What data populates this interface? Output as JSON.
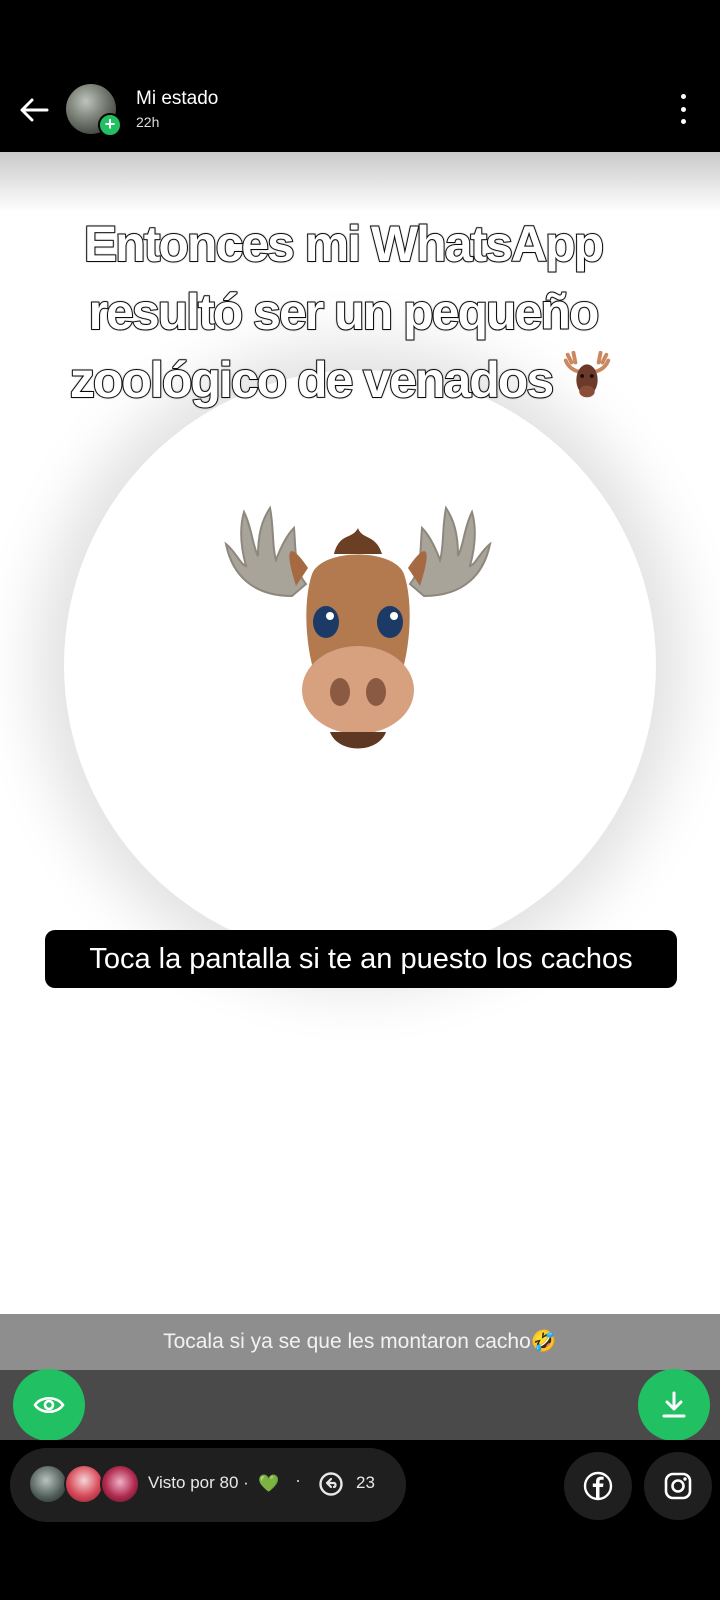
{
  "header": {
    "title": "Mi estado",
    "time": "22h",
    "avatar_badge": "+"
  },
  "post": {
    "headline": "Entonces mi WhatsApp resultó ser un pequeño zoológico de venados",
    "caption": "Toca la pantalla si te an puesto los cachos"
  },
  "reply_strip": {
    "text": "Tocala  si ya se que les montaron cacho🤣"
  },
  "footer": {
    "seen_label": "Visto por 80 ·",
    "heart": "💚",
    "separator": "·",
    "reshare_count": "23"
  },
  "icons": {
    "back": "arrow-left-icon",
    "menu": "more-vertical-icon",
    "eye": "eye-icon",
    "download": "download-icon",
    "reshare": "reshare-icon",
    "facebook": "facebook-icon",
    "instagram": "instagram-icon",
    "moose": "moose-emoji"
  },
  "colors": {
    "accent": "#21c063",
    "bar_dark": "#000000",
    "caption_bg": "#000000"
  }
}
